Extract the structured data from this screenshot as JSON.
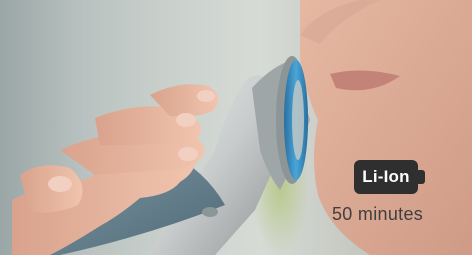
{
  "feature": {
    "battery_label": "Li-Ion",
    "runtime_text": "50 minutes",
    "icon": "battery-icon"
  },
  "colors": {
    "badge_background": "#2f2f2f",
    "badge_text": "#ffffff",
    "runtime_text": "#3f3f3f",
    "shaver_head_accent": "#3d8fc0"
  }
}
